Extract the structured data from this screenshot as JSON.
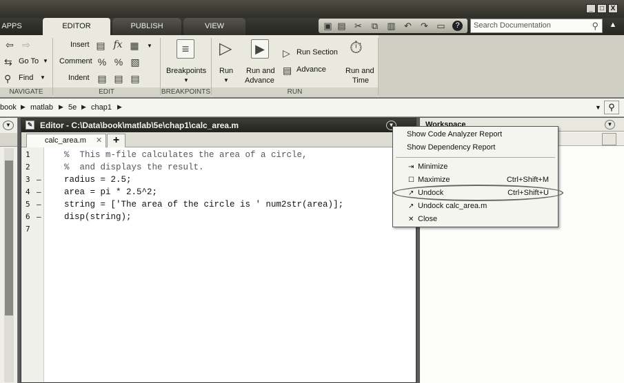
{
  "tabs": {
    "apps": "APPS",
    "editor": "EDITOR",
    "publish": "PUBLISH",
    "view": "VIEW"
  },
  "window_controls": {
    "minimize": "_",
    "maximize": "□",
    "close": "X"
  },
  "search": {
    "placeholder": "Search Documentation"
  },
  "ribbon": {
    "navigate": {
      "goto": "Go To",
      "find": "Find",
      "label": "NAVIGATE"
    },
    "edit": {
      "insert": "Insert",
      "comment": "Comment",
      "indent": "Indent",
      "label": "EDIT"
    },
    "breakpoints": {
      "button": "Breakpoints",
      "label": "BREAKPOINTS"
    },
    "run": {
      "run": "Run",
      "run_and_advance_1": "Run and",
      "run_and_advance_2": "Advance",
      "run_section": "Run Section",
      "advance": "Advance",
      "run_and_time_1": "Run and",
      "run_and_time_2": "Time",
      "label": "RUN"
    }
  },
  "address_bar": {
    "crumbs": [
      "book",
      "matlab",
      "5e",
      "chap1"
    ]
  },
  "editor": {
    "title": "Editor - C:\\Data\\book\\matlab\\5e\\chap1\\calc_area.m",
    "file_tab": "calc_area.m",
    "new_tab": "+",
    "lines": [
      {
        "num": "1",
        "dash": "",
        "text": "%  This m-file calculates the area of a circle,"
      },
      {
        "num": "2",
        "dash": "",
        "text": "%  and displays the result."
      },
      {
        "num": "3",
        "dash": "—",
        "text": "radius = 2.5;"
      },
      {
        "num": "4",
        "dash": "—",
        "text": "area = pi * 2.5^2;"
      },
      {
        "num": "5",
        "dash": "—",
        "text": "string = ['The area of the circle is ' num2str(area)];"
      },
      {
        "num": "6",
        "dash": "—",
        "text": "disp(string);"
      },
      {
        "num": "7",
        "dash": "",
        "text": ""
      }
    ]
  },
  "workspace": {
    "title": "Workspace"
  },
  "context_menu": {
    "show_code_analyzer": "Show Code Analyzer Report",
    "show_dependency": "Show Dependency Report",
    "minimize": "Minimize",
    "maximize": "Maximize",
    "maximize_shortcut": "Ctrl+Shift+M",
    "undock": "Undock",
    "undock_shortcut": "Ctrl+Shift+U",
    "undock_file": "Undock calc_area.m",
    "close": "Close"
  }
}
